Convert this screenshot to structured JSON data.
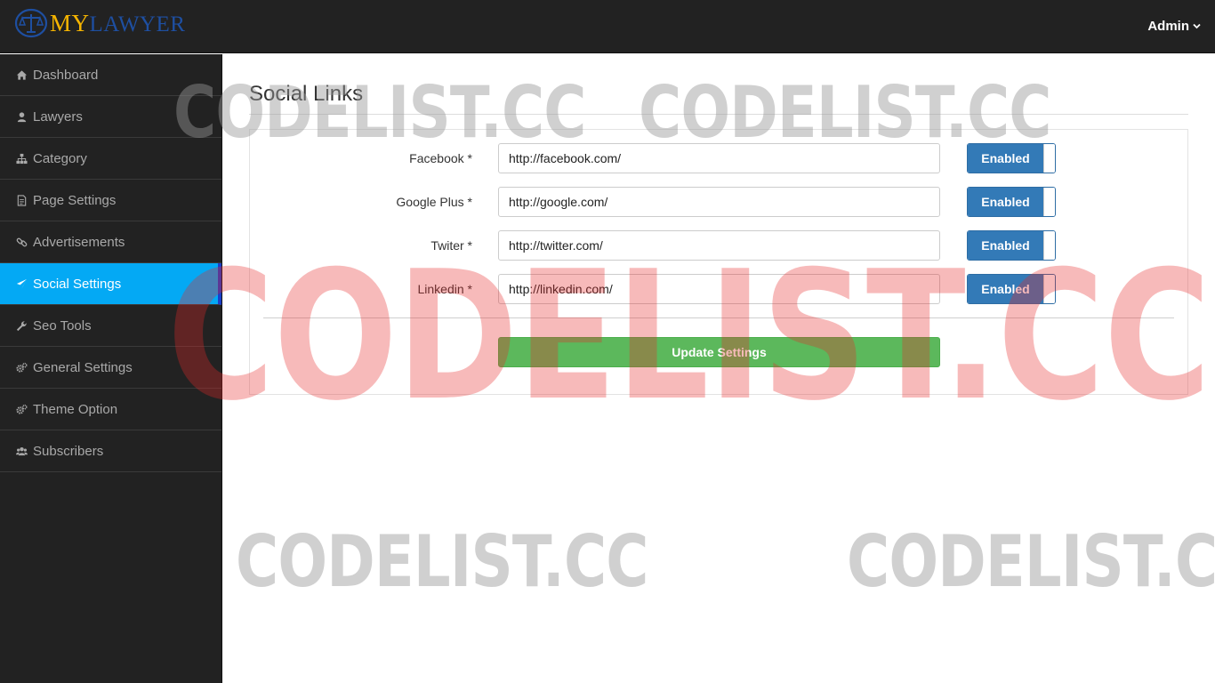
{
  "header": {
    "logo_my": "MY",
    "logo_rest": "LAWYER",
    "user_label": "Admin",
    "user_chevron": "⌄"
  },
  "sidebar": {
    "items": [
      {
        "label": "Dashboard",
        "icon": "home-icon"
      },
      {
        "label": "Lawyers",
        "icon": "user-icon"
      },
      {
        "label": "Category",
        "icon": "sitemap-icon"
      },
      {
        "label": "Page Settings",
        "icon": "file-icon"
      },
      {
        "label": "Advertisements",
        "icon": "link-icon"
      },
      {
        "label": "Social Settings",
        "icon": "paper-plane-icon",
        "active": true
      },
      {
        "label": "Seo Tools",
        "icon": "wrench-icon"
      },
      {
        "label": "General Settings",
        "icon": "gears-icon"
      },
      {
        "label": "Theme Option",
        "icon": "gears-icon"
      },
      {
        "label": "Subscribers",
        "icon": "users-icon"
      }
    ],
    "active_color": "#04a9f4"
  },
  "main": {
    "title": "Social Links",
    "fields": [
      {
        "label": "Facebook *",
        "value": "http://facebook.com/",
        "toggle": "Enabled"
      },
      {
        "label": "Google Plus *",
        "value": "http://google.com/",
        "toggle": "Enabled"
      },
      {
        "label": "Twiter *",
        "value": "http://twitter.com/",
        "toggle": "Enabled"
      },
      {
        "label": "Linkedin *",
        "value": "http://linkedin.com/",
        "toggle": "Enabled"
      }
    ],
    "submit_label": "Update Settings"
  },
  "watermark": "CODELIST.CC",
  "colors": {
    "topbar": "#222222",
    "toggle_on": "#337ab7",
    "submit": "#5cb85c",
    "logo_gold": "#f5b400",
    "logo_blue": "#1e4fa1"
  }
}
